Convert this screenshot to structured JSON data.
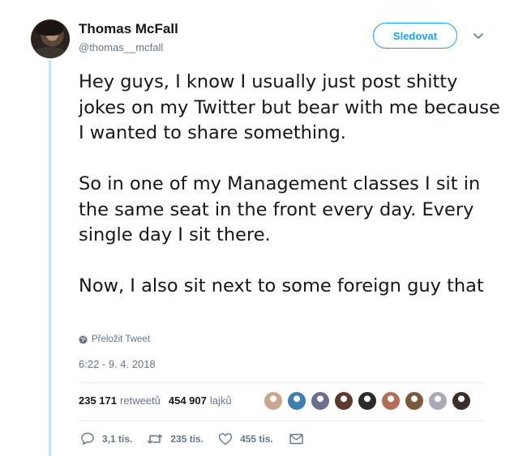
{
  "tweet": {
    "author_name": "Thomas McFall",
    "author_handle": "@thomas__mcfall",
    "follow_label": "Sledovat",
    "paragraphs": [
      "Hey guys, I know I usually just post shitty jokes on my Twitter but bear with me because I wanted to share something.",
      "So in one of my Management classes I sit in the same seat in the front every day. Every single day I sit there.",
      "Now, I also sit next to some foreign guy that"
    ],
    "translate_label": "Přeložit Tweet",
    "timestamp": "6:22 - 9. 4. 2018"
  },
  "stats": {
    "retweets_count": "235 171",
    "retweets_label": "retweetů",
    "likes_count": "454 907",
    "likes_label": "lajků"
  },
  "likers": [
    {
      "icon": "liker-avatar",
      "color": "#c9a68e"
    },
    {
      "icon": "liker-avatar",
      "color": "#3d7fb3"
    },
    {
      "icon": "liker-avatar",
      "color": "#6b6f8c"
    },
    {
      "icon": "liker-avatar",
      "color": "#5c3a2e"
    },
    {
      "icon": "liker-avatar",
      "color": "#2b2b2b"
    },
    {
      "icon": "liker-avatar",
      "color": "#b46d57"
    },
    {
      "icon": "liker-avatar",
      "color": "#7a5a3c"
    },
    {
      "icon": "liker-avatar",
      "color": "#a9a9b8"
    },
    {
      "icon": "liker-avatar",
      "color": "#3b2f2a"
    }
  ],
  "actions": {
    "reply_count": "3,1 tis.",
    "retweet_count": "235 tis.",
    "like_count": "455 tis."
  },
  "colors": {
    "accent": "#1da1f2",
    "thread_line": "#c4e5f8",
    "secondary_text": "#657786",
    "primary_text": "#14171a"
  }
}
